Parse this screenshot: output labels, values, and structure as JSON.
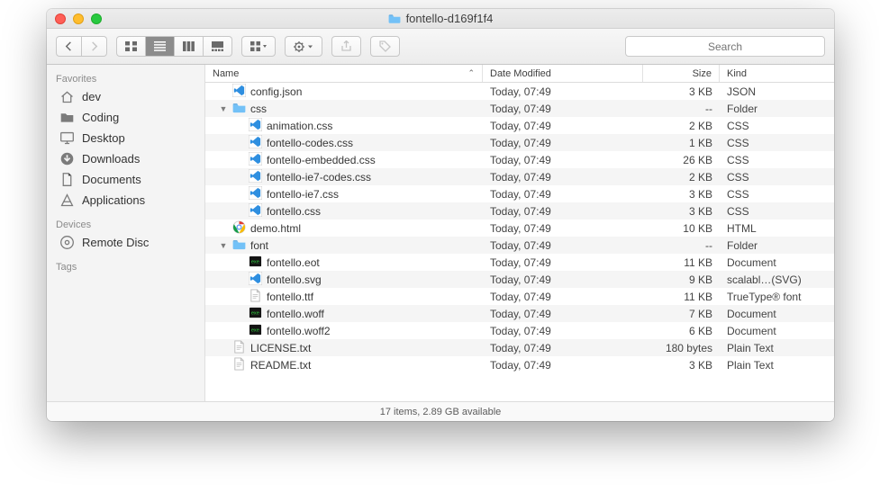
{
  "window": {
    "title": "fontello-d169f1f4"
  },
  "search": {
    "placeholder": "Search"
  },
  "sidebar": {
    "groups": [
      {
        "label": "Favorites",
        "items": [
          {
            "icon": "house",
            "name": "dev"
          },
          {
            "icon": "folder-o",
            "name": "Coding"
          },
          {
            "icon": "desktop",
            "name": "Desktop"
          },
          {
            "icon": "download",
            "name": "Downloads"
          },
          {
            "icon": "doc",
            "name": "Documents"
          },
          {
            "icon": "apps",
            "name": "Applications"
          }
        ]
      },
      {
        "label": "Devices",
        "items": [
          {
            "icon": "disc",
            "name": "Remote Disc"
          }
        ]
      },
      {
        "label": "Tags",
        "items": []
      }
    ]
  },
  "columns": {
    "name": "Name",
    "date": "Date Modified",
    "size": "Size",
    "kind": "Kind"
  },
  "files": [
    {
      "level": 0,
      "disclosure": "",
      "icon": "vscode",
      "name": "config.json",
      "date": "Today, 07:49",
      "size": "3 KB",
      "kind": "JSON"
    },
    {
      "level": 0,
      "disclosure": "▼",
      "icon": "folder",
      "name": "css",
      "date": "Today, 07:49",
      "size": "--",
      "kind": "Folder"
    },
    {
      "level": 1,
      "disclosure": "",
      "icon": "vscode",
      "name": "animation.css",
      "date": "Today, 07:49",
      "size": "2 KB",
      "kind": "CSS"
    },
    {
      "level": 1,
      "disclosure": "",
      "icon": "vscode",
      "name": "fontello-codes.css",
      "date": "Today, 07:49",
      "size": "1 KB",
      "kind": "CSS"
    },
    {
      "level": 1,
      "disclosure": "",
      "icon": "vscode",
      "name": "fontello-embedded.css",
      "date": "Today, 07:49",
      "size": "26 KB",
      "kind": "CSS"
    },
    {
      "level": 1,
      "disclosure": "",
      "icon": "vscode",
      "name": "fontello-ie7-codes.css",
      "date": "Today, 07:49",
      "size": "2 KB",
      "kind": "CSS"
    },
    {
      "level": 1,
      "disclosure": "",
      "icon": "vscode",
      "name": "fontello-ie7.css",
      "date": "Today, 07:49",
      "size": "3 KB",
      "kind": "CSS"
    },
    {
      "level": 1,
      "disclosure": "",
      "icon": "vscode",
      "name": "fontello.css",
      "date": "Today, 07:49",
      "size": "3 KB",
      "kind": "CSS"
    },
    {
      "level": 0,
      "disclosure": "",
      "icon": "chrome",
      "name": "demo.html",
      "date": "Today, 07:49",
      "size": "10 KB",
      "kind": "HTML"
    },
    {
      "level": 0,
      "disclosure": "▼",
      "icon": "folder",
      "name": "font",
      "date": "Today, 07:49",
      "size": "--",
      "kind": "Folder"
    },
    {
      "level": 1,
      "disclosure": "",
      "icon": "exec",
      "name": "fontello.eot",
      "date": "Today, 07:49",
      "size": "11 KB",
      "kind": "Document"
    },
    {
      "level": 1,
      "disclosure": "",
      "icon": "vscode",
      "name": "fontello.svg",
      "date": "Today, 07:49",
      "size": "9 KB",
      "kind": "scalabl…(SVG)"
    },
    {
      "level": 1,
      "disclosure": "",
      "icon": "plain",
      "name": "fontello.ttf",
      "date": "Today, 07:49",
      "size": "11 KB",
      "kind": "TrueType® font"
    },
    {
      "level": 1,
      "disclosure": "",
      "icon": "exec",
      "name": "fontello.woff",
      "date": "Today, 07:49",
      "size": "7 KB",
      "kind": "Document"
    },
    {
      "level": 1,
      "disclosure": "",
      "icon": "exec",
      "name": "fontello.woff2",
      "date": "Today, 07:49",
      "size": "6 KB",
      "kind": "Document"
    },
    {
      "level": 0,
      "disclosure": "",
      "icon": "plain",
      "name": "LICENSE.txt",
      "date": "Today, 07:49",
      "size": "180 bytes",
      "kind": "Plain Text"
    },
    {
      "level": 0,
      "disclosure": "",
      "icon": "plain",
      "name": "README.txt",
      "date": "Today, 07:49",
      "size": "3 KB",
      "kind": "Plain Text"
    }
  ],
  "status": "17 items, 2.89 GB available"
}
